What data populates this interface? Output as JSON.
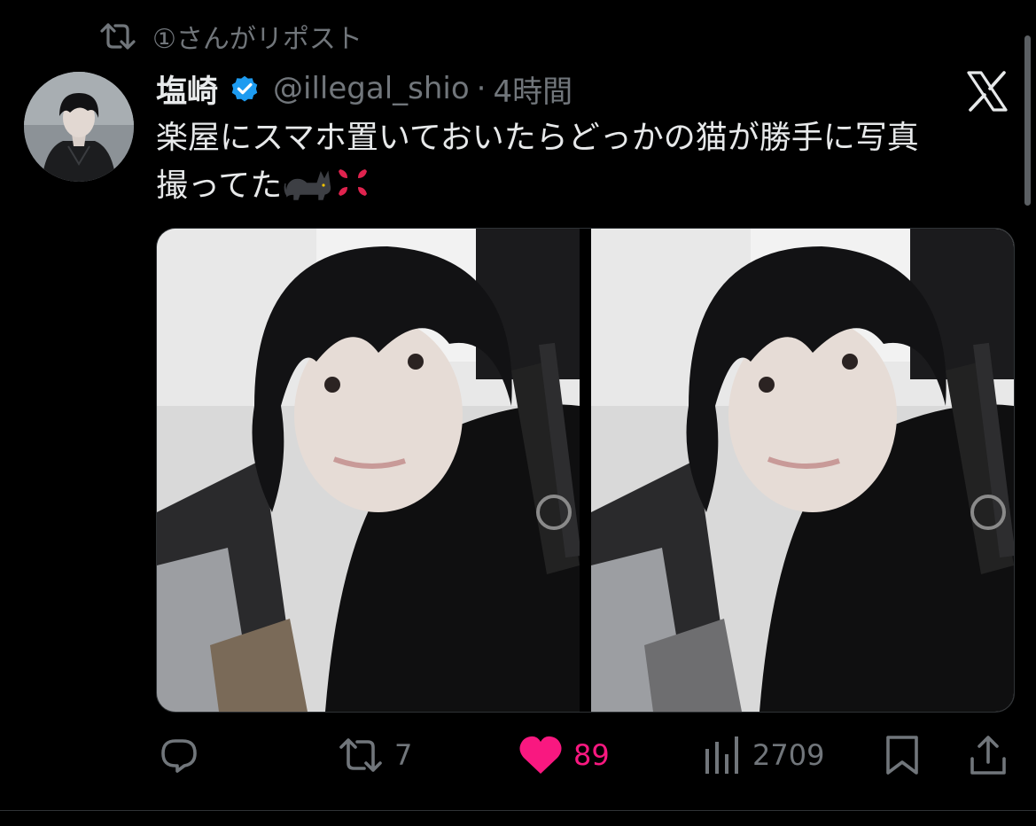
{
  "repost": {
    "icon": "repost-icon",
    "text": "①さんがリポスト"
  },
  "tweet": {
    "display_name": "塩崎",
    "verified_icon": "verified-badge-icon",
    "handle": "@illegal_shio",
    "separator": "·",
    "time": "4時間",
    "text_line1": "楽屋にスマホ置いておいたらどっかの猫が勝手に写真",
    "text_line2": "撮ってた",
    "emoji_icons": [
      "black-cat-emoji",
      "anger-symbol-emoji"
    ],
    "media": [
      {
        "name": "photo-1"
      },
      {
        "name": "photo-2"
      }
    ]
  },
  "brand_logo": "x-logo-icon",
  "actions": {
    "reply": {
      "icon": "reply-icon"
    },
    "repost": {
      "icon": "repost-icon",
      "count": "7"
    },
    "like": {
      "icon": "heart-filled-icon",
      "count": "89",
      "color": "#f91880"
    },
    "views": {
      "icon": "views-bar-chart-icon",
      "count": "2709"
    },
    "bookmark": {
      "icon": "bookmark-icon"
    },
    "share": {
      "icon": "share-icon"
    }
  },
  "colors": {
    "background": "#000000",
    "text_primary": "#e7e9ea",
    "text_secondary": "#71767b",
    "verified": "#1d9bf0",
    "like": "#f91880"
  }
}
